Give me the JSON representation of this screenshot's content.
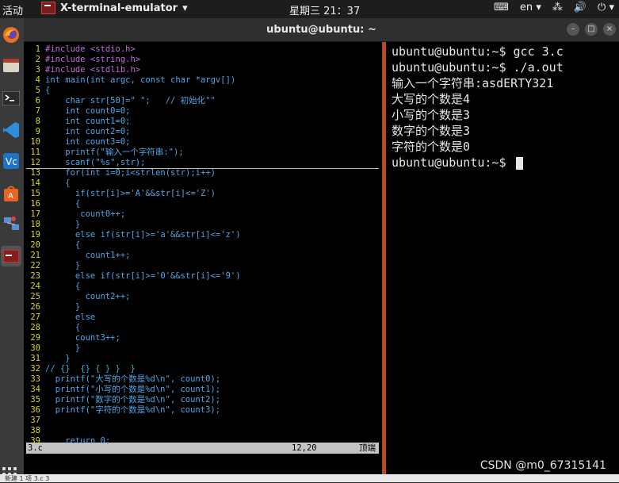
{
  "topbar": {
    "activities": "活动",
    "app_name": "X-terminal-emulator",
    "app_arrow": "▾",
    "clock": "星期三 21：37",
    "keyboard_icon": "⌨",
    "lang": "en",
    "lang_arrow": "▾",
    "network_icon": "⁂",
    "volume_icon": "🔊",
    "power_icon": "⏻",
    "power_arrow": "▾"
  },
  "dock": {
    "items": [
      "firefox",
      "files",
      "terminal",
      "vscode",
      "vmware",
      "software",
      "network",
      "terminal-active"
    ]
  },
  "window": {
    "title": "ubuntu@ubuntu: ~",
    "min": "–",
    "max": "□",
    "close": "×"
  },
  "vim": {
    "lines": [
      {
        "n": "1",
        "t": "#include <stdio.h>"
      },
      {
        "n": "2",
        "t": "#include <string.h>"
      },
      {
        "n": "3",
        "t": "#include <stdlib.h>"
      },
      {
        "n": "4",
        "t": "int main(int argc, const char *argv[])"
      },
      {
        "n": "5",
        "t": "{"
      },
      {
        "n": "6",
        "t": "    char str[50]=\" \";   // 初始化\"\""
      },
      {
        "n": "7",
        "t": "    int count0=0;"
      },
      {
        "n": "8",
        "t": "    int count1=0;"
      },
      {
        "n": "9",
        "t": "    int count2=0;"
      },
      {
        "n": "10",
        "t": "    int count3=0;"
      },
      {
        "n": "11",
        "t": "    printf(\"输入一个字符串:\");"
      },
      {
        "n": "12",
        "t": "    scanf(\"%s\",str);"
      },
      {
        "n": "13",
        "t": "    for(int i=0;i<strlen(str);i++)"
      },
      {
        "n": "14",
        "t": "    {"
      },
      {
        "n": "15",
        "t": "      if(str[i]>='A'&&str[i]<='Z')"
      },
      {
        "n": "16",
        "t": "      {"
      },
      {
        "n": "17",
        "t": "       count0++;"
      },
      {
        "n": "18",
        "t": "      }"
      },
      {
        "n": "19",
        "t": "      else if(str[i]>='a'&&str[i]<='z')"
      },
      {
        "n": "20",
        "t": "      {"
      },
      {
        "n": "21",
        "t": "        count1++;"
      },
      {
        "n": "22",
        "t": "      }"
      },
      {
        "n": "23",
        "t": "      else if(str[i]>='0'&&str[i]<='9')"
      },
      {
        "n": "24",
        "t": "      {"
      },
      {
        "n": "25",
        "t": "        count2++;"
      },
      {
        "n": "26",
        "t": "      }"
      },
      {
        "n": "27",
        "t": "      else"
      },
      {
        "n": "28",
        "t": "      {"
      },
      {
        "n": "29",
        "t": "      count3++;"
      },
      {
        "n": "30",
        "t": "      }"
      },
      {
        "n": "31",
        "t": "    }"
      },
      {
        "n": "32",
        "t": "// {}  {} { } }  }"
      },
      {
        "n": "33",
        "t": "  printf(\"大写的个数是%d\\n\", count0);"
      },
      {
        "n": "34",
        "t": "  printf(\"小写的个数是%d\\n\", count1);"
      },
      {
        "n": "35",
        "t": "  printf(\"数字的个数是%d\\n\", count2);"
      },
      {
        "n": "36",
        "t": "  printf(\"字符的个数是%d\\n\", count3);"
      },
      {
        "n": "37",
        "t": ""
      },
      {
        "n": "38",
        "t": ""
      },
      {
        "n": "39",
        "t": "    return 0;"
      }
    ],
    "status_file": "3.c",
    "status_pos": "12,20",
    "status_scroll": "顶端"
  },
  "shell": {
    "lines": [
      "ubuntu@ubuntu:~$ gcc 3.c",
      "ubuntu@ubuntu:~$ ./a.out",
      "输入一个字符串:asdERTY321",
      "大写的个数是4",
      "小写的个数是3",
      "数字的个数是3",
      "字符的个数是0",
      "ubuntu@ubuntu:~$ "
    ]
  },
  "watermark": "CSDN @m0_67315141",
  "bottom_text": "新建 1 项 3.c 3"
}
